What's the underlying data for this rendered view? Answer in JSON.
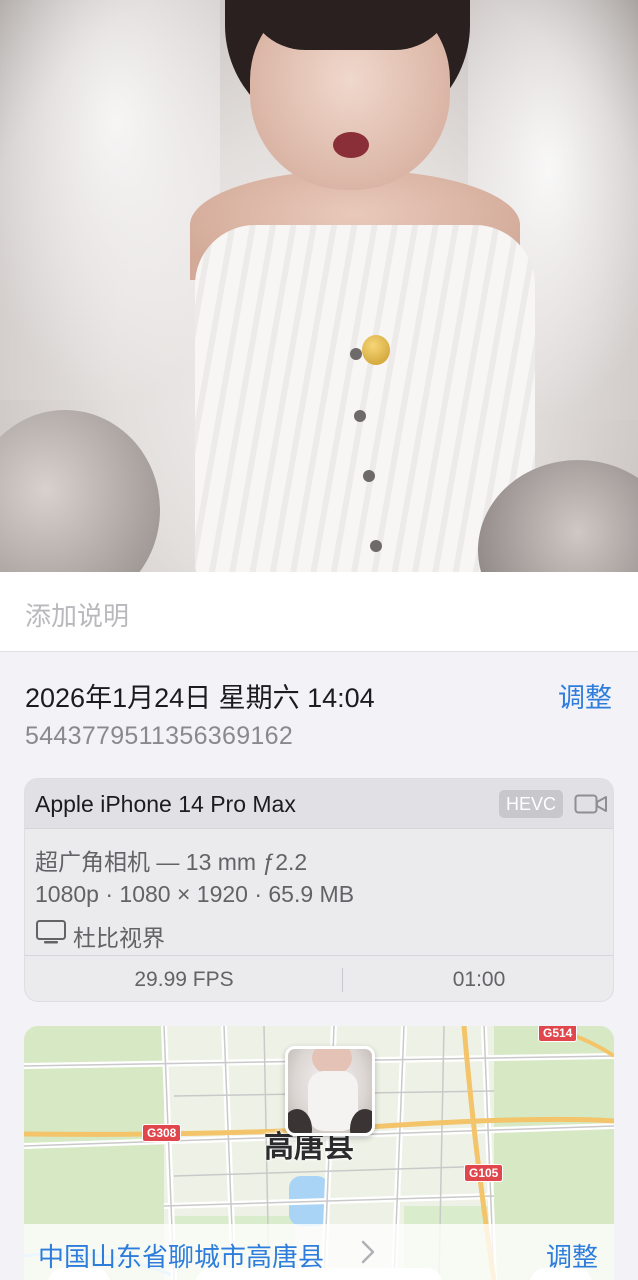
{
  "caption": {
    "placeholder": "添加说明"
  },
  "datetime": {
    "text": "2026年1月24日 星期六 14:04",
    "adjust_label": "调整"
  },
  "asset_id": "5443779511356369162",
  "device": {
    "model": "Apple iPhone 14 Pro Max",
    "format_badge": "HEVC",
    "camera_icon": "video-camera-icon",
    "lens": "超广角相机 — 13 mm ƒ2.2",
    "resolution": "1080p · 1080 × 1920 · 65.9 MB",
    "hdr_icon": "display-icon",
    "hdr": "杜比视界",
    "fps": "29.99 FPS",
    "duration": "01:00"
  },
  "map": {
    "city_label": "高唐县",
    "roads": [
      "G308",
      "G105",
      "G514"
    ],
    "location": "中国山东省聊城市高唐县",
    "adjust_label": "调整"
  },
  "colors": {
    "accent": "#2e7ddc",
    "background": "#f2f2f7",
    "card": "#ebebee",
    "road_badge": "#e0474c"
  }
}
